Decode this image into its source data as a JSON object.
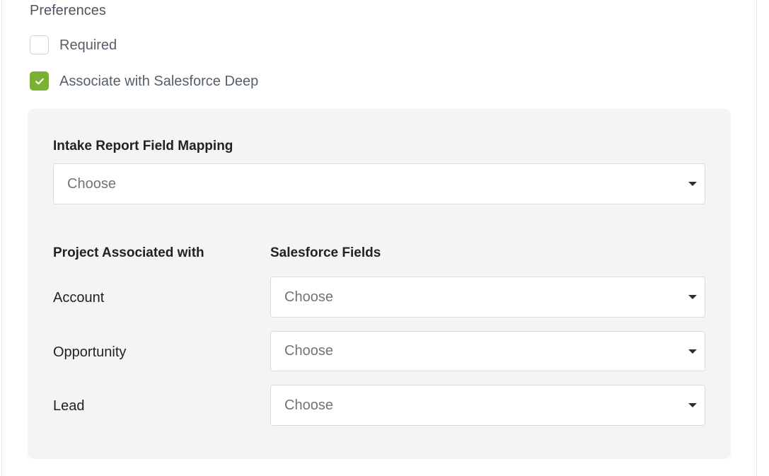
{
  "preferences": {
    "title": "Preferences",
    "required_label": "Required",
    "associate_label": "Associate with Salesforce Deep",
    "required_checked": false,
    "associate_checked": true,
    "accent_color": "#7ab034"
  },
  "mapping": {
    "intake_heading": "Intake Report Field Mapping",
    "intake_select_value": "Choose",
    "col_project_heading": "Project Associated with",
    "col_salesforce_heading": "Salesforce Fields",
    "rows": [
      {
        "label": "Account",
        "select_value": "Choose"
      },
      {
        "label": "Opportunity",
        "select_value": "Choose"
      },
      {
        "label": "Lead",
        "select_value": "Choose"
      }
    ]
  }
}
